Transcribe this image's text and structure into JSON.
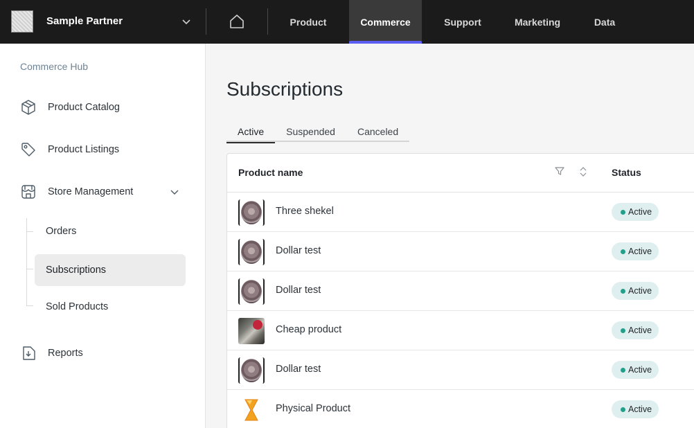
{
  "topbar": {
    "partner_name": "Sample Partner",
    "nav": [
      {
        "label": "Product"
      },
      {
        "label": "Commerce"
      },
      {
        "label": "Support"
      },
      {
        "label": "Marketing"
      },
      {
        "label": "Data"
      }
    ],
    "active_nav": "Commerce",
    "accent_color": "#5b5ef0"
  },
  "sidebar": {
    "title": "Commerce Hub",
    "items": [
      {
        "label": "Product Catalog",
        "icon": "box-icon"
      },
      {
        "label": "Product Listings",
        "icon": "tag-icon"
      },
      {
        "label": "Store Management",
        "icon": "store-icon"
      },
      {
        "label": "Reports",
        "icon": "report-icon"
      }
    ],
    "store_management_children": [
      {
        "label": "Orders"
      },
      {
        "label": "Subscriptions"
      },
      {
        "label": "Sold Products"
      }
    ],
    "selected": "Subscriptions"
  },
  "main": {
    "title": "Subscriptions",
    "tabs": [
      {
        "label": "Active"
      },
      {
        "label": "Suspended"
      },
      {
        "label": "Canceled"
      }
    ],
    "active_tab": "Active",
    "table": {
      "columns": [
        "Product name",
        "Status"
      ],
      "rows": [
        {
          "name": "Three shekel",
          "status": "Active",
          "thumb": "coin"
        },
        {
          "name": "Dollar test",
          "status": "Active",
          "thumb": "coin"
        },
        {
          "name": "Dollar test",
          "status": "Active",
          "thumb": "coin"
        },
        {
          "name": "Cheap product",
          "status": "Active",
          "thumb": "cat"
        },
        {
          "name": "Dollar test",
          "status": "Active",
          "thumb": "coin"
        },
        {
          "name": "Physical Product",
          "status": "Active",
          "thumb": "hourglass"
        }
      ],
      "status_color": "#23a08a"
    }
  }
}
